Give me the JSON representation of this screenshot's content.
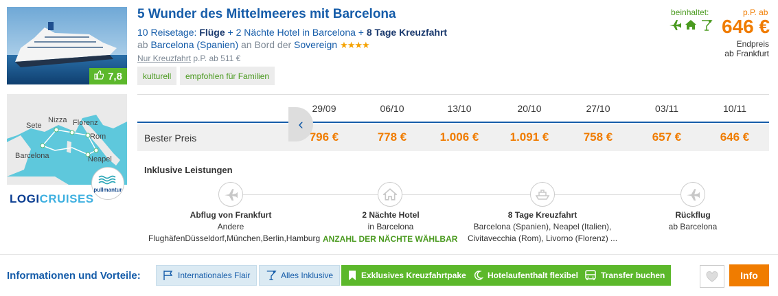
{
  "offer": {
    "title": "5 Wunder des Mittelmeeres mit Barcelona",
    "line2": {
      "prefix": "10 Reisetage: ",
      "flights": "Flüge",
      "plus1": " + 2 Nächte Hotel in Barcelona + ",
      "cruise": "8 Tage Kreuzfahrt"
    },
    "line3": {
      "ab": "ab ",
      "port": "Barcelona (Spanien)",
      "an": " an Bord der ",
      "ship": "Sovereign",
      "stars": "★★★★"
    },
    "line4": {
      "link": "Nur Kreuzfahrt",
      "rest": " p.P. ab 511 €"
    },
    "tags": [
      "kulturell",
      "empfohlen für Familien"
    ],
    "rating": "7,8"
  },
  "price_box": {
    "includes_label": "beinhaltet:",
    "pp_label": "p.P. ab",
    "price": "646 €",
    "end_label_1": "Endpreis",
    "end_label_2": "ab Frankfurt"
  },
  "map": {
    "labels": [
      "Sete",
      "Nizza",
      "Florenz",
      "Rom",
      "Barcelona",
      "Neapel"
    ],
    "operator": "pullmantur",
    "logo_a": "LOGI",
    "logo_b": "CRUISES"
  },
  "dates": [
    "29/09",
    "06/10",
    "13/10",
    "20/10",
    "27/10",
    "03/11",
    "10/11"
  ],
  "best_price_label": "Bester Preis",
  "prices": [
    "796 €",
    "778 €",
    "1.006 €",
    "1.091 €",
    "758 €",
    "657 €",
    "646 €"
  ],
  "inclusive": {
    "heading": "Inklusive Leistungen",
    "blocks": [
      {
        "title": "Abflug von Frankfurt",
        "l1": "Andere",
        "l2": "FlughäfenDüsseldorf,München,Berlin,Hamburg",
        "icon": "plane-icon"
      },
      {
        "title": "2 Nächte Hotel",
        "l1": "in Barcelona",
        "l2": "",
        "icon": "hotel-icon"
      },
      {
        "title": "8 Tage Kreuzfahrt",
        "l1": "Barcelona (Spanien), Neapel (Italien),",
        "l2": "Civitavecchia (Rom), Livorno (Florenz) ...",
        "icon": "ship-icon"
      },
      {
        "title": "Rückflug",
        "l1": "ab Barcelona",
        "l2": "",
        "icon": "plane-icon"
      }
    ],
    "nights_link": "ANZAHL DER NÄCHTE WÄHLBAR"
  },
  "bottom": {
    "title": "Informationen und Vorteile:",
    "chips": [
      {
        "label": "Internationales Flair",
        "style": "light",
        "icon": "flag-icon"
      },
      {
        "label": "Alles Inklusive",
        "style": "light",
        "icon": "cocktail-icon"
      },
      {
        "label": "Exklusives Kreuzfahrtpaket",
        "style": "green",
        "icon": "bookmark-icon"
      },
      {
        "label": "Hotelaufenthalt flexibel",
        "style": "green",
        "icon": "moon-icon"
      },
      {
        "label": "Transfer buchen",
        "style": "green",
        "icon": "bus-icon"
      }
    ],
    "info_button": "Info"
  },
  "colors": {
    "blue": "#155ca9",
    "green": "#5cb82b",
    "orange": "#f07c00"
  }
}
